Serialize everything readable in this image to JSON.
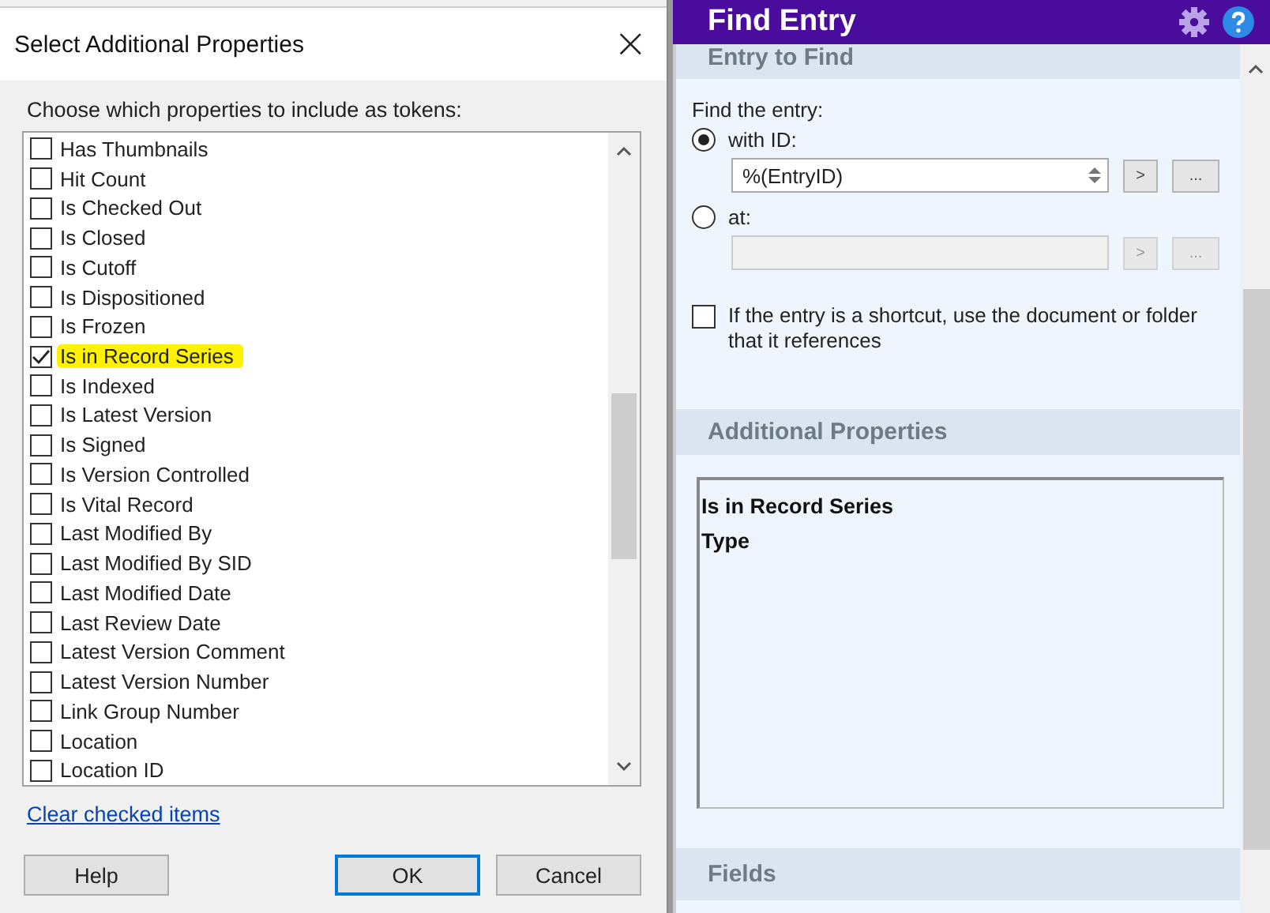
{
  "dialog": {
    "title": "Select Additional Properties",
    "close": "×",
    "prompt": "Choose which properties to include as tokens:",
    "properties": [
      {
        "label": "Has Thumbnails",
        "checked": false,
        "highlighted": false
      },
      {
        "label": "Hit Count",
        "checked": false,
        "highlighted": false
      },
      {
        "label": "Is Checked Out",
        "checked": false,
        "highlighted": false
      },
      {
        "label": "Is Closed",
        "checked": false,
        "highlighted": false
      },
      {
        "label": "Is Cutoff",
        "checked": false,
        "highlighted": false
      },
      {
        "label": "Is Dispositioned",
        "checked": false,
        "highlighted": false
      },
      {
        "label": "Is Frozen",
        "checked": false,
        "highlighted": false
      },
      {
        "label": "Is in Record Series",
        "checked": true,
        "highlighted": true
      },
      {
        "label": "Is Indexed",
        "checked": false,
        "highlighted": false
      },
      {
        "label": "Is Latest Version",
        "checked": false,
        "highlighted": false
      },
      {
        "label": "Is Signed",
        "checked": false,
        "highlighted": false
      },
      {
        "label": "Is Version Controlled",
        "checked": false,
        "highlighted": false
      },
      {
        "label": "Is Vital Record",
        "checked": false,
        "highlighted": false
      },
      {
        "label": "Last Modified By",
        "checked": false,
        "highlighted": false
      },
      {
        "label": "Last Modified By SID",
        "checked": false,
        "highlighted": false
      },
      {
        "label": "Last Modified Date",
        "checked": false,
        "highlighted": false
      },
      {
        "label": "Last Review Date",
        "checked": false,
        "highlighted": false
      },
      {
        "label": "Latest Version Comment",
        "checked": false,
        "highlighted": false
      },
      {
        "label": "Latest Version Number",
        "checked": false,
        "highlighted": false
      },
      {
        "label": "Link Group Number",
        "checked": false,
        "highlighted": false
      },
      {
        "label": "Location",
        "checked": false,
        "highlighted": false
      },
      {
        "label": "Location ID",
        "checked": false,
        "highlighted": false
      }
    ],
    "clear_link": "Clear checked items",
    "buttons": [
      {
        "label": "Help",
        "default": false
      },
      {
        "label": "OK",
        "default": true
      },
      {
        "label": "Cancel",
        "default": false
      }
    ]
  },
  "find_entry": {
    "title": "Find Entry",
    "entry_to_find": {
      "heading": "Entry to Find",
      "prompt": "Find the entry:",
      "options": [
        {
          "label": "with ID:",
          "selected": true,
          "value": "%(EntryID)",
          "disabled": false,
          "buttons": [
            ">",
            "..."
          ]
        },
        {
          "label": "at:",
          "selected": false,
          "disabled": true,
          "buttons": [
            ">",
            "..."
          ]
        }
      ],
      "shortcut": {
        "label": "If the entry is a shortcut, use the document or folder that it references",
        "checked": false
      }
    },
    "additional_properties": {
      "heading": "Additional Properties",
      "items": [
        "Is in Record Series",
        "Type"
      ]
    },
    "fields": {
      "heading": "Fields"
    }
  }
}
